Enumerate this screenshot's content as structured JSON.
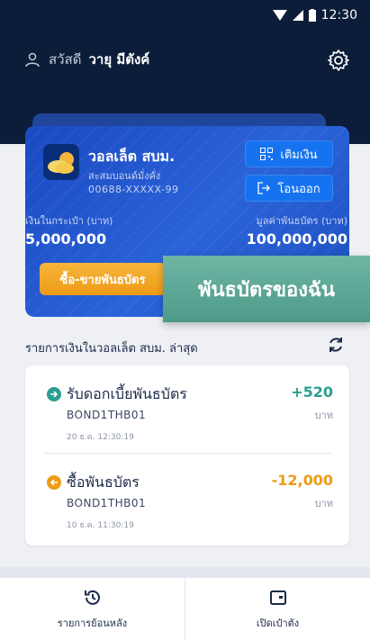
{
  "status_bar": {
    "time": "12:30"
  },
  "header": {
    "greeting": "สวัสดี",
    "user_name": "วายุ มีตังค์"
  },
  "wallet": {
    "title": "วอลเล็ต สบม.",
    "subtitle": "สะสมบอนด์มั่งคั่ง",
    "account": "00688-XXXXX-99",
    "topup_label": "เติมเงิน",
    "transfer_label": "โอนออก",
    "balance_label": "เงินในกระเป๋า (บาท)",
    "balance_value": "5,000,000",
    "bond_value_label": "มูลค่าพันธบัตร (บาท)",
    "bond_value": "100,000,000",
    "buy_sell_label": "ซื้อ-ขายพันธบัตร",
    "my_bonds_label": "พันธบัตรของฉัน"
  },
  "transactions": {
    "title": "รายการเงินในวอลเล็ต สบม. ล่าสุด",
    "items": [
      {
        "name": "รับดอกเบี้ยพันธบัตร",
        "code": "BOND1THB01",
        "date": "20 ธ.ค. 12:30:19",
        "amount": "+520",
        "unit": "บาท",
        "color": "#2a9d8f",
        "icon": "arrow-right-circle-icon"
      },
      {
        "name": "ซื้อพันธบัตร",
        "code": "BOND1THB01",
        "date": "10 ธ.ค. 11:30:19",
        "amount": "-12,000",
        "unit": "บาท",
        "color": "#ee9b17",
        "icon": "arrow-left-circle-icon"
      }
    ]
  },
  "bottom_nav": {
    "history_label": "รายการย้อนหลัง",
    "open_wallet_label": "เปิดเป๋าตัง"
  }
}
